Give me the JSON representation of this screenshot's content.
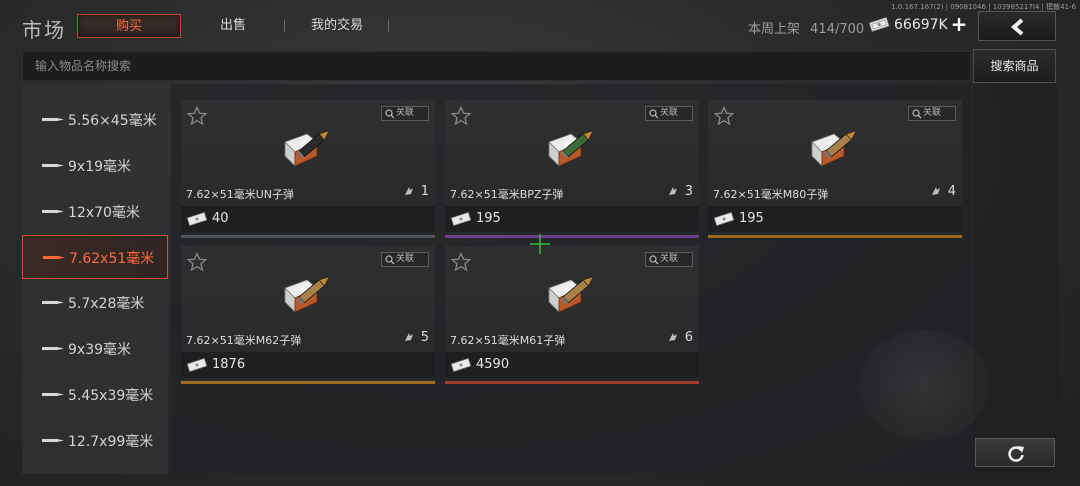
{
  "version": "1.0.167.167(2) | 09081046 | 103985217I4 | 模散41-6",
  "header": {
    "title": "市场",
    "tabs": [
      {
        "label": "购买",
        "active": true
      },
      {
        "label": "出售",
        "active": false
      },
      {
        "label": "我的交易",
        "active": false
      }
    ],
    "weekly_listing_label": "本周上架",
    "weekly_listing_value": "414/700",
    "currency_amount": "66697K",
    "currency_icon": "cash-icon",
    "add_icon": "plus-icon",
    "back_icon": "chevron-left-icon"
  },
  "search": {
    "placeholder": "输入物品名称搜索",
    "value": "",
    "button_label": "搜索商品"
  },
  "sidebar": {
    "items": [
      {
        "label": "5.56×45毫米",
        "active": false
      },
      {
        "label": "9x19毫米",
        "active": false
      },
      {
        "label": "12x70毫米",
        "active": false
      },
      {
        "label": "7.62x51毫米",
        "active": true
      },
      {
        "label": "5.7x28毫米",
        "active": false
      },
      {
        "label": "9x39毫米",
        "active": false
      },
      {
        "label": "5.45x39毫米",
        "active": false
      },
      {
        "label": "12.7x99毫米",
        "active": false
      }
    ]
  },
  "items": [
    {
      "name": "7.62×51毫米UN子弹",
      "count": "1",
      "price": "40",
      "assoc_label": "关联",
      "casing_color": "#2b2b2b",
      "rarity_color": "#505458"
    },
    {
      "name": "7.62×51毫米BPZ子弹",
      "count": "3",
      "price": "195",
      "assoc_label": "关联",
      "casing_color": "#3f6b3a",
      "rarity_color": "#6e3f8a"
    },
    {
      "name": "7.62×51毫米M80子弹",
      "count": "4",
      "price": "195",
      "assoc_label": "关联",
      "casing_color": "#a8814a",
      "rarity_color": "#a06a1e"
    },
    {
      "name": "7.62×51毫米M62子弹",
      "count": "5",
      "price": "1876",
      "assoc_label": "关联",
      "casing_color": "#a8814a",
      "rarity_color": "#a06a1e"
    },
    {
      "name": "7.62×51毫米M61子弹",
      "count": "6",
      "price": "4590",
      "assoc_label": "关联",
      "casing_color": "#a8814a",
      "rarity_color": "#a33a2e"
    }
  ],
  "colors": {
    "accent": "#ff6a3c",
    "active_border": "#d2522b"
  },
  "refresh_icon": "refresh-icon"
}
